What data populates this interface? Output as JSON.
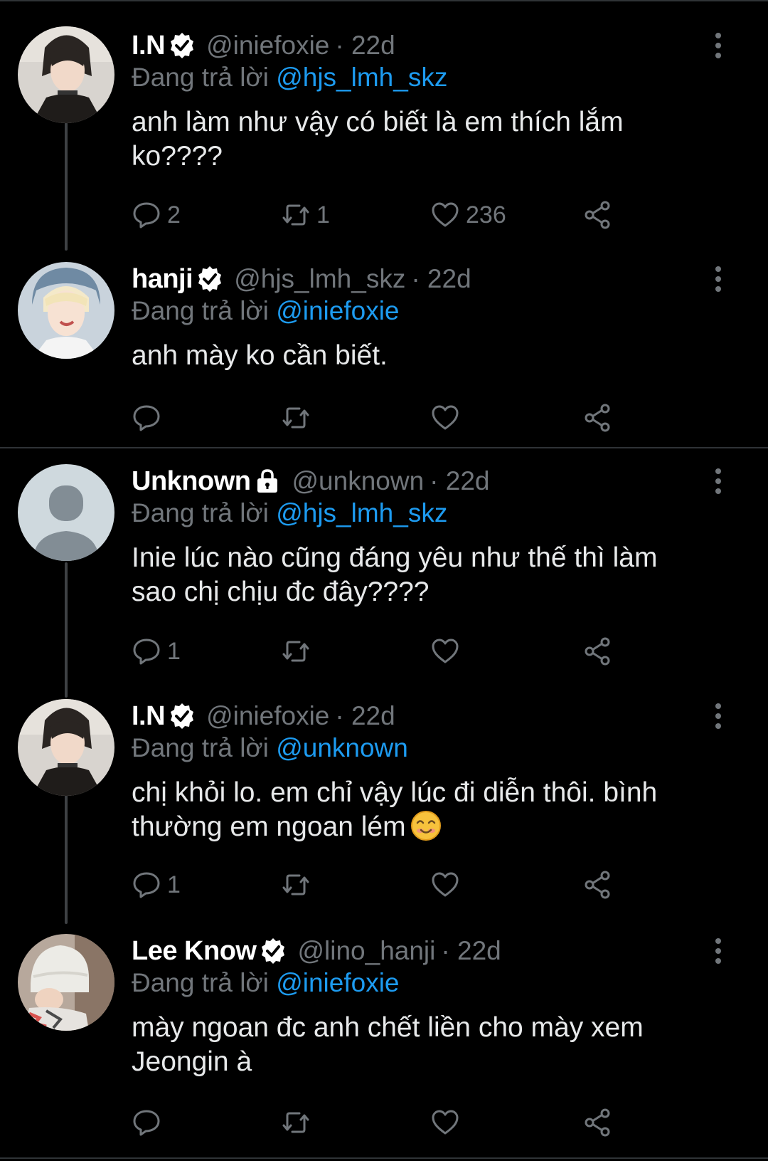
{
  "tweets": [
    {
      "name": "I.N",
      "badge": "verified-icon",
      "handle": "@iniefoxie",
      "time": "· 22d",
      "reply_prefix": "Đang trả lời ",
      "reply_to": "@hjs_lmh_skz",
      "text": "anh làm như vậy có biết là em thích lắm ko????",
      "reply_count": "2",
      "retweet_count": "1",
      "like_count": "236"
    },
    {
      "name": "hanji",
      "badge": "verified-icon",
      "handle": "@hjs_lmh_skz",
      "time": "· 22d",
      "reply_prefix": "Đang trả lời ",
      "reply_to": "@iniefoxie",
      "text": "anh mày ko cần biết.",
      "reply_count": "",
      "retweet_count": "",
      "like_count": ""
    },
    {
      "name": "Unknown",
      "badge": "lock-icon",
      "handle": "@unknown",
      "time": "· 22d",
      "reply_prefix": "Đang trả lời ",
      "reply_to": "@hjs_lmh_skz",
      "text": "Inie lúc nào cũng đáng yêu như thế thì làm sao chị chịu đc đây????",
      "reply_count": "1",
      "retweet_count": "",
      "like_count": ""
    },
    {
      "name": "I.N",
      "badge": "verified-icon",
      "handle": "@iniefoxie",
      "time": "· 22d",
      "reply_prefix": "Đang trả lời ",
      "reply_to": "@unknown",
      "text": "chị khỏi lo. em chỉ vậy lúc đi diễn thôi. bình thường em ngoan lém",
      "emoji": "smiling-face-emoji",
      "reply_count": "1",
      "retweet_count": "",
      "like_count": ""
    },
    {
      "name": "Lee Know",
      "badge": "verified-icon",
      "handle": "@lino_hanji",
      "time": "· 22d",
      "reply_prefix": "Đang trả lời ",
      "reply_to": "@iniefoxie",
      "text": "mày ngoan đc anh chết liền cho mày xem Jeongin à",
      "reply_count": "",
      "retweet_count": "",
      "like_count": ""
    }
  ],
  "colors": {
    "background": "#000000",
    "mention": "#1d9bf0",
    "secondary_text": "#71767b",
    "divider": "#2f3336"
  }
}
